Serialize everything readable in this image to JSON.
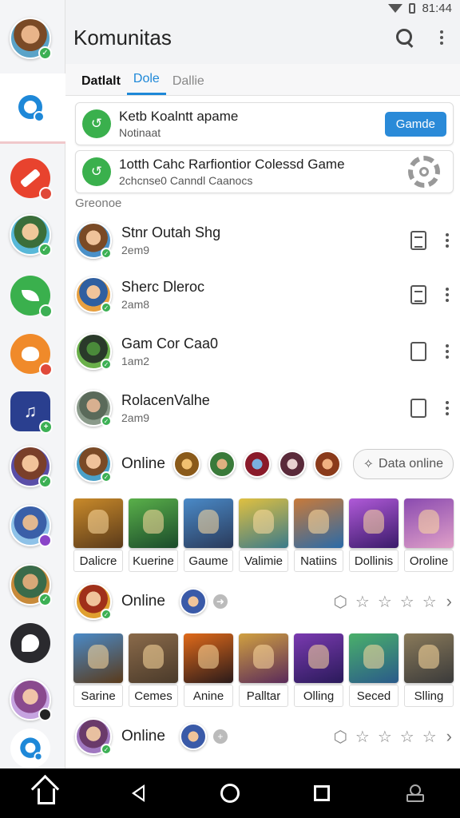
{
  "status": {
    "time": "81:44"
  },
  "app": {
    "title": "Komunitas"
  },
  "tabs": [
    {
      "label": "Datlalt"
    },
    {
      "label": "Dole"
    },
    {
      "label": "Dallie"
    }
  ],
  "cards": [
    {
      "title": "Ketb Koalntt apame",
      "subtitle": "Notinaat",
      "button": "Gamde"
    },
    {
      "title": "1otth Cahc Rarfiontior Colessd Game",
      "subtitle": "2chcnse0 Canndl Caanocs"
    }
  ],
  "section_label": "Greonoe",
  "chats": [
    {
      "name": "Stnr Outah Shg",
      "time": "2em9"
    },
    {
      "name": "Sherc Dleroc",
      "time": "2am8"
    },
    {
      "name": "Gam Cor Caa0",
      "time": "1am2"
    },
    {
      "name": "RolacenValhe",
      "time": "2am9"
    }
  ],
  "online_rows": [
    {
      "label": "Online",
      "action": "Data online"
    },
    {
      "label": "Online"
    },
    {
      "label": "Online"
    }
  ],
  "tiles_1": [
    "Dalicre",
    "Kuerine",
    "Gaume",
    "Valimie",
    "Natiins",
    "Dollinis",
    "Oroline"
  ],
  "tiles_2": [
    "Sarine",
    "Cemes",
    "Anine",
    "Palltar",
    "Olling",
    "Seced",
    "Slling"
  ],
  "colors": {
    "accent": "#1e88d8",
    "green": "#3ab04d",
    "badge_blue": "#2f7fd6"
  },
  "icons": {
    "search": "search-icon",
    "more": "more-vert-icon"
  }
}
